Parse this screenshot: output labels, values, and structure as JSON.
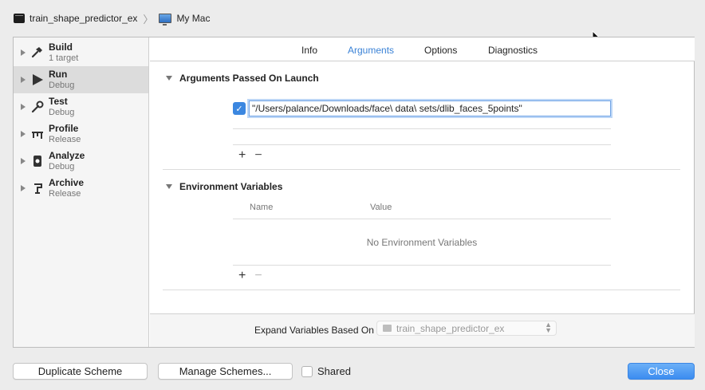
{
  "breadcrumb": {
    "scheme": "train_shape_predictor_ex",
    "destination": "My Mac"
  },
  "sidebar": {
    "items": [
      {
        "title": "Build",
        "subtitle": "1 target"
      },
      {
        "title": "Run",
        "subtitle": "Debug"
      },
      {
        "title": "Test",
        "subtitle": "Debug"
      },
      {
        "title": "Profile",
        "subtitle": "Release"
      },
      {
        "title": "Analyze",
        "subtitle": "Debug"
      },
      {
        "title": "Archive",
        "subtitle": "Release"
      }
    ],
    "selected": "Run"
  },
  "tabs": [
    "Info",
    "Arguments",
    "Options",
    "Diagnostics"
  ],
  "active_tab": "Arguments",
  "arguments": {
    "title": "Arguments Passed On Launch",
    "items": [
      {
        "enabled": true,
        "value": "\"/Users/palance/Downloads/face\\ data\\ sets/dlib_faces_5points\""
      }
    ],
    "add": "+",
    "remove": "−"
  },
  "environment": {
    "title": "Environment Variables",
    "col_name": "Name",
    "col_value": "Value",
    "empty": "No Environment Variables",
    "add": "+",
    "remove": "−"
  },
  "expand": {
    "label": "Expand Variables Based On",
    "selected": "train_shape_predictor_ex"
  },
  "footer": {
    "duplicate": "Duplicate Scheme",
    "manage": "Manage Schemes...",
    "shared": "Shared",
    "shared_checked": false,
    "close": "Close"
  },
  "colors": {
    "accent": "#3b87e0",
    "tab_active": "#3a82d6"
  }
}
